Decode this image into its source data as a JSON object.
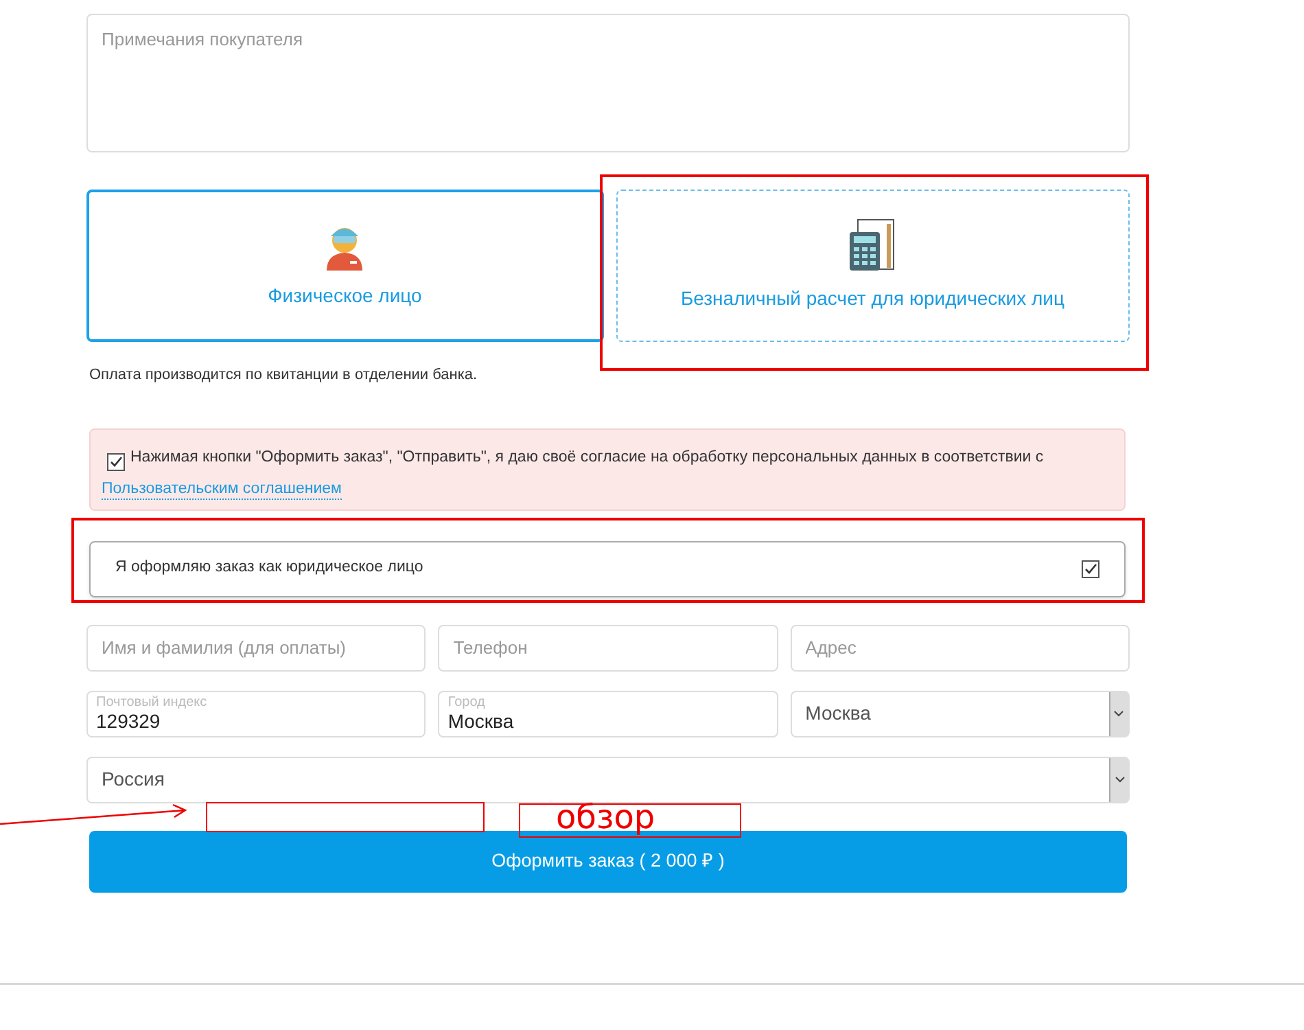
{
  "notes_field": {
    "placeholder": "Примечания покупателя"
  },
  "payment_options": [
    {
      "kind": "person",
      "label": "Физическое лицо",
      "selected": true
    },
    {
      "kind": "company",
      "label": "Безналичный расчет для юридических лиц",
      "selected": false
    }
  ],
  "payment_note": "Оплата производится по квитанции в отделении банка.",
  "consent": {
    "checked": true,
    "text": "Нажимая кнопки \"Оформить заказ\", \"Отправить\", я даю своё согласие на обработку персональных данных в соответствии с",
    "link": "Пользовательским соглашением"
  },
  "legal_entity": {
    "label": "Я оформляю заказ как юридическое лицо",
    "checked": true
  },
  "fields": [
    {
      "placeholder": "Имя и фамилия (для оплаты)"
    },
    {
      "placeholder": "Телефон"
    },
    {
      "placeholder": "Адрес"
    }
  ],
  "address": {
    "postcode": {
      "label": "Почтовый индекс",
      "value": "129329"
    },
    "city": {
      "label": "Город",
      "value": "Москва"
    },
    "region": "Москва",
    "country": "Россия"
  },
  "submit_button": "Оформить заказ ( 2 000 ₽ )",
  "annotation": {
    "text": "обзор"
  }
}
